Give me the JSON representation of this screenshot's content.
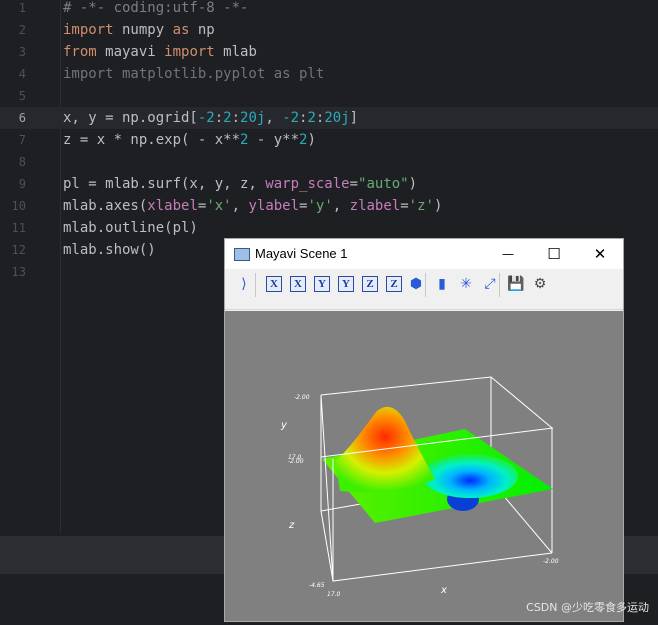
{
  "editor": {
    "current_line": 6,
    "lines": [
      {
        "n": "1",
        "tokens": [
          {
            "t": "# -*- coding:utf-8 -*-",
            "c": "cm"
          }
        ]
      },
      {
        "n": "2",
        "tokens": [
          {
            "t": "import",
            "c": "kw"
          },
          {
            "t": " numpy ",
            "c": ""
          },
          {
            "t": "as",
            "c": "kw"
          },
          {
            "t": " np",
            "c": ""
          }
        ]
      },
      {
        "n": "3",
        "tokens": [
          {
            "t": "from",
            "c": "kw"
          },
          {
            "t": " mayavi ",
            "c": ""
          },
          {
            "t": "import",
            "c": "kw"
          },
          {
            "t": " mlab",
            "c": ""
          }
        ]
      },
      {
        "n": "4",
        "tokens": [
          {
            "t": "import matplotlib.pyplot as plt",
            "c": "dim"
          }
        ]
      },
      {
        "n": "5",
        "tokens": []
      },
      {
        "n": "6",
        "tokens": [
          {
            "t": "x, y = np.ogrid[",
            "c": ""
          },
          {
            "t": "-2",
            "c": "num"
          },
          {
            "t": ":",
            "c": ""
          },
          {
            "t": "2",
            "c": "num"
          },
          {
            "t": ":",
            "c": ""
          },
          {
            "t": "20j",
            "c": "num"
          },
          {
            "t": ", ",
            "c": ""
          },
          {
            "t": "-2",
            "c": "num"
          },
          {
            "t": ":",
            "c": ""
          },
          {
            "t": "2",
            "c": "num"
          },
          {
            "t": ":",
            "c": ""
          },
          {
            "t": "20j",
            "c": "num"
          },
          {
            "t": "]",
            "c": ""
          }
        ]
      },
      {
        "n": "7",
        "tokens": [
          {
            "t": "z = x * np.exp( - x**",
            "c": ""
          },
          {
            "t": "2",
            "c": "num"
          },
          {
            "t": " - y**",
            "c": ""
          },
          {
            "t": "2",
            "c": "num"
          },
          {
            "t": ")",
            "c": ""
          }
        ]
      },
      {
        "n": "8",
        "tokens": []
      },
      {
        "n": "9",
        "tokens": [
          {
            "t": "pl = mlab.surf(x, y, z, ",
            "c": ""
          },
          {
            "t": "warp_scale",
            "c": "prm"
          },
          {
            "t": "=",
            "c": ""
          },
          {
            "t": "\"auto\"",
            "c": "str"
          },
          {
            "t": ")",
            "c": ""
          }
        ]
      },
      {
        "n": "10",
        "tokens": [
          {
            "t": "mlab.axes(",
            "c": ""
          },
          {
            "t": "xlabel",
            "c": "prm"
          },
          {
            "t": "=",
            "c": ""
          },
          {
            "t": "'x'",
            "c": "str"
          },
          {
            "t": ", ",
            "c": ""
          },
          {
            "t": "ylabel",
            "c": "prm"
          },
          {
            "t": "=",
            "c": ""
          },
          {
            "t": "'y'",
            "c": "str"
          },
          {
            "t": ", ",
            "c": ""
          },
          {
            "t": "zlabel",
            "c": "prm"
          },
          {
            "t": "=",
            "c": ""
          },
          {
            "t": "'z'",
            "c": "str"
          },
          {
            "t": ")",
            "c": ""
          }
        ]
      },
      {
        "n": "11",
        "tokens": [
          {
            "t": "mlab.outline(pl)",
            "c": ""
          }
        ]
      },
      {
        "n": "12",
        "tokens": [
          {
            "t": "mlab.show()",
            "c": ""
          }
        ]
      },
      {
        "n": "13",
        "tokens": []
      }
    ]
  },
  "window": {
    "title": "Mayavi Scene 1",
    "minimize_glyph": "—",
    "maximize_glyph": "☐",
    "close_glyph": "✕",
    "toolbar_buttons": [
      {
        "name": "pipeline-icon",
        "kind": "icon",
        "glyph": "⟩"
      },
      {
        "name": "view-x-plus-button",
        "kind": "axis",
        "glyph": "X"
      },
      {
        "name": "view-x-minus-button",
        "kind": "axis",
        "glyph": "X"
      },
      {
        "name": "view-y-plus-button",
        "kind": "axis",
        "glyph": "Y"
      },
      {
        "name": "view-y-minus-button",
        "kind": "axis",
        "glyph": "Y"
      },
      {
        "name": "view-z-plus-button",
        "kind": "axis",
        "glyph": "Z"
      },
      {
        "name": "view-z-minus-button",
        "kind": "axis",
        "glyph": "Z"
      },
      {
        "name": "isometric-view-button",
        "kind": "icon",
        "glyph": "⬢"
      },
      {
        "name": "parallel-projection-button",
        "kind": "icon",
        "glyph": "▮"
      },
      {
        "name": "axes-indicator-button",
        "kind": "icon",
        "glyph": "✳"
      },
      {
        "name": "full-screen-button",
        "kind": "icon",
        "glyph": "⤢"
      },
      {
        "name": "save-scene-button",
        "kind": "icon",
        "glyph": "💾"
      },
      {
        "name": "settings-button",
        "kind": "icon",
        "glyph": "⚙"
      }
    ],
    "scene": {
      "background_color": "#808080",
      "x_label": "x",
      "y_label": "y",
      "z_label": "z",
      "tick_top": "-2.00",
      "tick_mid": "17.0",
      "tick_mid2": "-2.00",
      "tick_bottom_left": "-4.65",
      "tick_bottom": "17.0",
      "tick_right": "-2.00"
    }
  },
  "watermark": "CSDN @少吃零食多运动",
  "colors": {
    "editor_bg": "#1e1f22",
    "keyword": "#cf8e6d",
    "number": "#2aacb8",
    "string": "#6aab73",
    "param": "#c77dbb",
    "comment": "#7a7e85"
  }
}
